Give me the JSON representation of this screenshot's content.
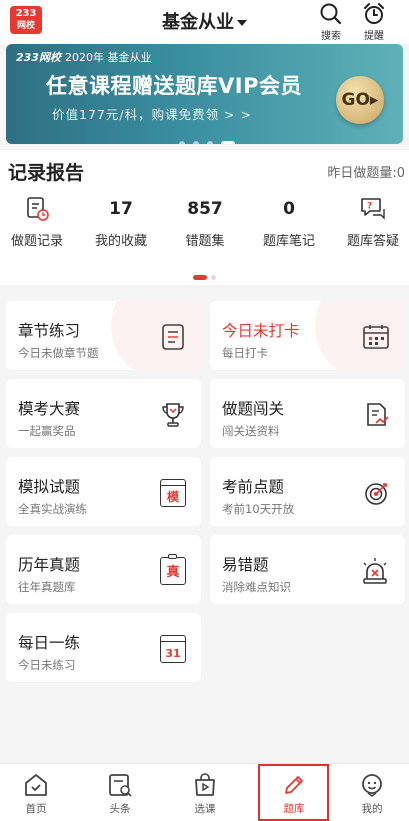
{
  "header": {
    "logo_line1": "233",
    "logo_line2": "网校",
    "title": "基金从业",
    "search_label": "搜索",
    "reminder_label": "提醒"
  },
  "banner": {
    "brand": "233网校",
    "caption": "2020年 基金从业",
    "headline": "任意课程赠送题库VIP会员",
    "subline": "价值177元/科，购课免费领 > >",
    "go_label": "GO",
    "slides": 4,
    "active_slide": 4
  },
  "report": {
    "title": "记录报告",
    "yesterday": "昨日做题量:0",
    "stats": [
      {
        "label": "做题记录",
        "icon": "practice-record-icon"
      },
      {
        "label": "我的收藏",
        "value": "17"
      },
      {
        "label": "错题集",
        "value": "857"
      },
      {
        "label": "题库笔记",
        "value": "0"
      },
      {
        "label": "题库答疑",
        "icon": "qa-chat-icon"
      }
    ]
  },
  "cards": [
    {
      "title": "章节练习",
      "sub": "今日未做章节题",
      "icon": "list-document-icon"
    },
    {
      "title": "今日未打卡",
      "sub": "每日打卡",
      "icon": "calendar-icon"
    },
    {
      "title": "模考大赛",
      "sub": "一起赢奖品",
      "icon": "trophy-icon"
    },
    {
      "title": "做题闯关",
      "sub": "闯关送资料",
      "icon": "document-trend-icon"
    },
    {
      "title": "模拟试题",
      "sub": "全真实战演练",
      "icon": "mock-window-icon",
      "icon_text": "模"
    },
    {
      "title": "考前点题",
      "sub": "考前10天开放",
      "icon": "target-icon"
    },
    {
      "title": "历年真题",
      "sub": "往年真题库",
      "icon": "clipboard-icon",
      "icon_text": "真"
    },
    {
      "title": "易错题",
      "sub": "消除难点知识",
      "icon": "alarm-light-icon"
    },
    {
      "title": "每日一练",
      "sub": "今日未练习",
      "icon": "calendar-day-icon",
      "icon_text": "31"
    }
  ],
  "tabbar": [
    {
      "label": "首页",
      "icon": "home-icon"
    },
    {
      "label": "头条",
      "icon": "news-icon"
    },
    {
      "label": "选课",
      "icon": "course-bag-icon"
    },
    {
      "label": "题库",
      "icon": "pencil-icon",
      "active": true
    },
    {
      "label": "我的",
      "icon": "profile-icon"
    }
  ],
  "colors": {
    "accent": "#e8382f",
    "banner_start": "#2f6f83",
    "banner_end": "#5fb0b7"
  }
}
